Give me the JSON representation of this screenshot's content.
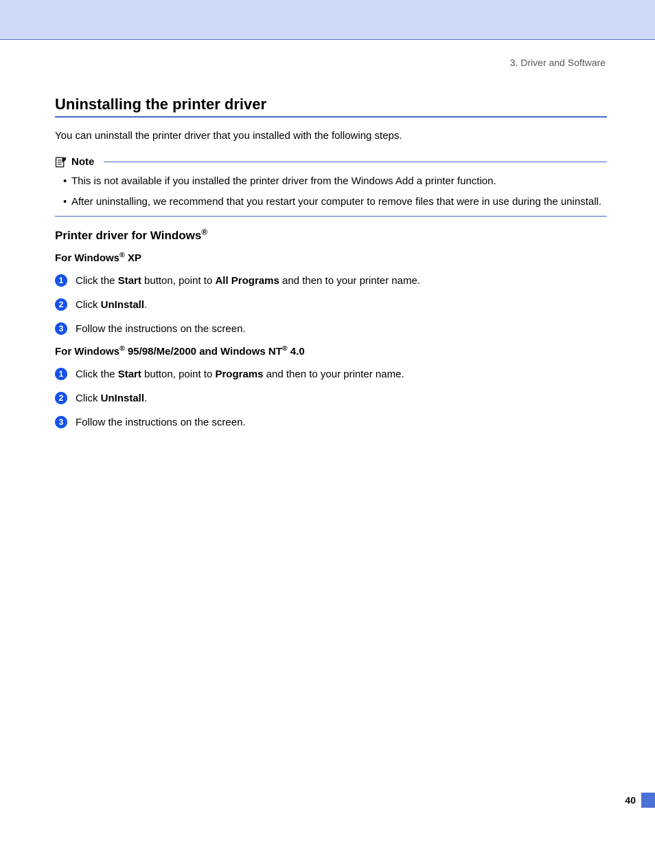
{
  "chapter_ref": "3. Driver and Software",
  "title": "Uninstalling the printer driver",
  "intro": "You can uninstall the printer driver that you installed with the following steps.",
  "note": {
    "label": "Note",
    "items": [
      "This is not available if you installed the printer driver from the Windows Add a printer function.",
      "After uninstalling, we recommend that you restart your computer to remove files that were in use during the uninstall."
    ]
  },
  "section": {
    "title_prefix": "Printer driver for Windows",
    "xp": {
      "heading_prefix": "For Windows",
      "heading_suffix": " XP",
      "steps": {
        "s1_a": "Click the ",
        "s1_b": "Start",
        "s1_c": " button, point to ",
        "s1_d": "All Programs",
        "s1_e": " and then to your printer name.",
        "s2_a": "Click ",
        "s2_b": "UnInstall",
        "s2_c": ".",
        "s3": "Follow the instructions on the screen."
      }
    },
    "legacy": {
      "heading_a": "For Windows",
      "heading_b": " 95/98/Me/2000 and Windows NT",
      "heading_c": " 4.0",
      "steps": {
        "s1_a": "Click the ",
        "s1_b": "Start",
        "s1_c": " button, point to ",
        "s1_d": "Programs",
        "s1_e": " and then to your printer name.",
        "s2_a": "Click ",
        "s2_b": "UnInstall",
        "s2_c": ".",
        "s3": "Follow the instructions on the screen."
      }
    }
  },
  "page_number": "40"
}
